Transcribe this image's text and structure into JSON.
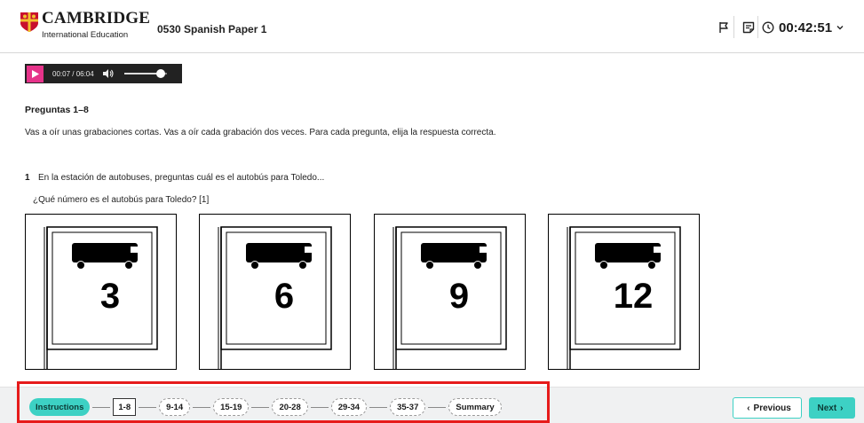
{
  "header": {
    "brand": "CAMBRIDGE",
    "brand_sub": "International Education",
    "paper_title": "0530 Spanish Paper 1",
    "timer": "00:42:51",
    "icons": [
      "flag-icon",
      "notepad-icon",
      "clock-icon",
      "chevron-down-icon"
    ]
  },
  "player": {
    "time": "00:07 / 06:04",
    "volume_level": 0.85,
    "icons": [
      "play-icon",
      "volume-icon"
    ]
  },
  "content": {
    "heading": "Preguntas 1–8",
    "instructions": "Vas a oír unas grabaciones cortas. Vas a oír cada grabación dos veces. Para cada pregunta, elija la respuesta correcta.",
    "question_number": "1",
    "question_text": "En la estación de autobuses, preguntas cuál es el autobús para Toledo...",
    "question_sub": "¿Qué número es el autobús para Toledo?   [1]",
    "options": [
      "3",
      "6",
      "9",
      "12"
    ]
  },
  "nav": {
    "items": [
      {
        "label": "Instructions",
        "state": "active"
      },
      {
        "label": "1-8",
        "state": "current"
      },
      {
        "label": "9-14",
        "state": "normal"
      },
      {
        "label": "15-19",
        "state": "normal"
      },
      {
        "label": "20-28",
        "state": "normal"
      },
      {
        "label": "29-34",
        "state": "normal"
      },
      {
        "label": "35-37",
        "state": "normal"
      },
      {
        "label": "Summary",
        "state": "normal"
      }
    ],
    "previous_label": "Previous",
    "next_label": "Next"
  },
  "colors": {
    "accent": "#3dd1c4",
    "play": "#e6338a",
    "highlight": "#e61b1b"
  }
}
